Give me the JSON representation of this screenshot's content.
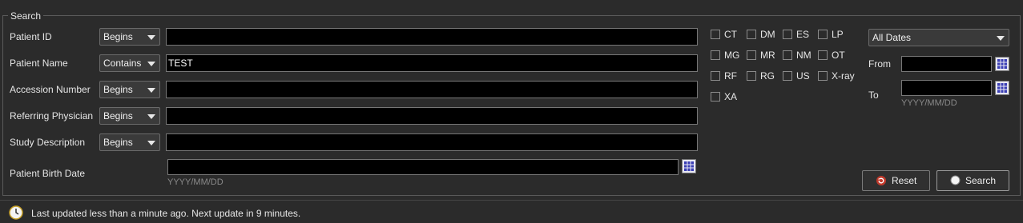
{
  "search": {
    "legend": "Search",
    "rows": [
      {
        "label": "Patient ID",
        "operator": "Begins",
        "value": ""
      },
      {
        "label": "Patient Name",
        "operator": "Contains",
        "value": "TEST"
      },
      {
        "label": "Accession Number",
        "operator": "Begins",
        "value": ""
      },
      {
        "label": "Referring Physician",
        "operator": "Begins",
        "value": ""
      },
      {
        "label": "Study Description",
        "operator": "Begins",
        "value": ""
      }
    ],
    "birth_date": {
      "label": "Patient Birth Date",
      "value": "",
      "hint": "YYYY/MM/DD"
    },
    "modalities": [
      "CT",
      "DM",
      "ES",
      "LP",
      "MG",
      "MR",
      "NM",
      "OT",
      "RF",
      "RG",
      "US",
      "X-ray",
      "XA"
    ],
    "dates": {
      "range": "All Dates",
      "from_label": "From",
      "from_value": "",
      "to_label": "To",
      "to_value": "",
      "hint": "YYYY/MM/DD"
    },
    "reset_label": "Reset",
    "search_label": "Search"
  },
  "status": {
    "text": "Last updated less than a minute ago. Next update in 9 minutes.",
    "icon": "clock-icon"
  },
  "colors": {
    "background": "#2b2b2b",
    "input_background": "#000000",
    "hint_text": "#8a8a8a",
    "reset_icon": "#c0392b"
  }
}
